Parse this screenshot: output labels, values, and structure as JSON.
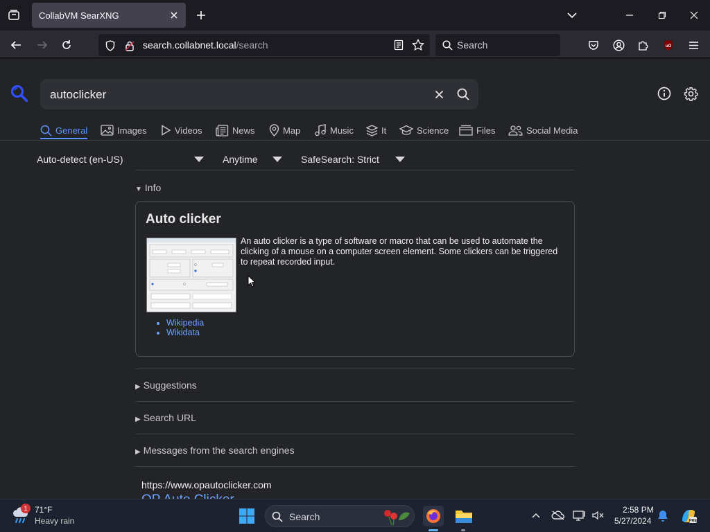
{
  "browser": {
    "tab_title": "CollabVM SearXNG",
    "url_host": "search.collabnet.local",
    "url_path": "/search",
    "search_placeholder": "Search"
  },
  "search": {
    "query": "autoclicker",
    "categories": [
      {
        "label": "General",
        "icon": "search-icon",
        "active": true
      },
      {
        "label": "Images",
        "icon": "image-icon"
      },
      {
        "label": "Videos",
        "icon": "play-icon"
      },
      {
        "label": "News",
        "icon": "newspaper-icon"
      },
      {
        "label": "Map",
        "icon": "map-pin-icon"
      },
      {
        "label": "Music",
        "icon": "music-icon"
      },
      {
        "label": "It",
        "icon": "layers-icon"
      },
      {
        "label": "Science",
        "icon": "graduation-cap-icon"
      },
      {
        "label": "Files",
        "icon": "files-icon"
      },
      {
        "label": "Social Media",
        "icon": "people-icon"
      }
    ],
    "filters": {
      "language": "Auto-detect (en-US)",
      "time": "Anytime",
      "safesearch": "SafeSearch: Strict"
    }
  },
  "info": {
    "section_label": "Info",
    "title": "Auto clicker",
    "description": "An auto clicker is a type of software or macro that can be used to automate the clicking of a mouse on a computer screen element. Some clickers can be triggered to repeat recorded input.",
    "links": [
      "Wikipedia",
      "Wikidata"
    ]
  },
  "sections": {
    "suggestions": "Suggestions",
    "search_url": "Search URL",
    "messages": "Messages from the search engines"
  },
  "result": {
    "url": "https://www.opautoclicker.com",
    "title": "OP Auto Clicker"
  },
  "taskbar": {
    "weather_temp": "71°F",
    "weather_desc": "Heavy rain",
    "weather_badge": "1",
    "search_placeholder": "Search",
    "time": "2:58 PM",
    "date": "5/27/2024"
  },
  "colors": {
    "accent": "#5f92ff",
    "link": "#6ea3ff"
  }
}
